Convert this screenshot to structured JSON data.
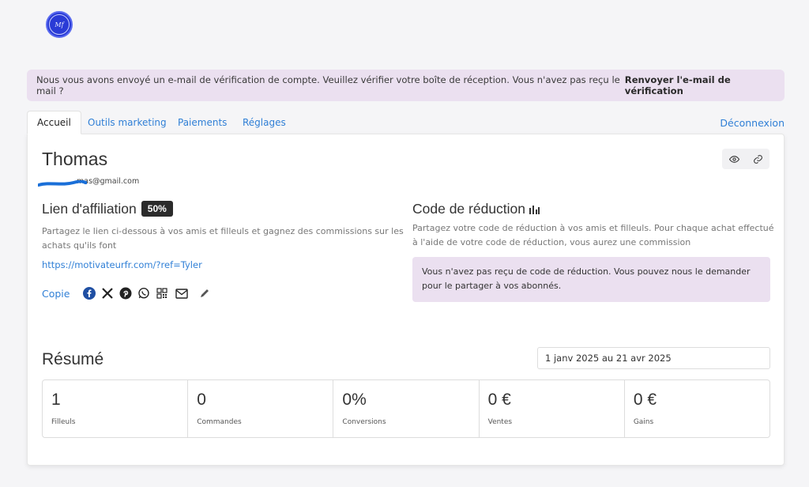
{
  "logo": {
    "text": "Mf"
  },
  "alert": {
    "message": "Nous vous avons envoyé un e-mail de vérification de compte. Veuillez vérifier votre boîte de réception. Vous n'avez pas reçu le mail ?",
    "action": "Renvoyer l'e-mail de vérification"
  },
  "tabs": [
    {
      "label": "Accueil"
    },
    {
      "label": "Outils marketing"
    },
    {
      "label": "Paiements"
    },
    {
      "label": "Réglages"
    }
  ],
  "logout_label": "Déconnexion",
  "profile": {
    "name": "Thomas",
    "email": "mas@gmail.com"
  },
  "affiliation": {
    "title": "Lien d'affiliation",
    "badge": "50%",
    "description": "Partagez le lien ci-dessous à vos amis et filleuls et gagnez des commissions sur les achats qu'ils font",
    "link": "https://motivateurfr.com/?ref=Tyler",
    "copy_label": "Copie",
    "share_icons": [
      "facebook-icon",
      "x-icon",
      "pinterest-icon",
      "whatsapp-icon",
      "qr-code-icon",
      "email-icon",
      "edit-icon"
    ]
  },
  "discount": {
    "title": "Code de réduction",
    "description": "Partagez votre code de réduction à vos amis et filleuls. Pour chaque achat effectué à l'aide de votre code de réduction, vous aurez une commission",
    "notice": "Vous n'avez pas reçu de code de réduction. Vous pouvez nous le demander pour le partager à vos abonnés."
  },
  "summary": {
    "title": "Résumé",
    "date_range": "1 janv 2025 au 21 avr 2025",
    "stats": [
      {
        "value": "1",
        "label": "Filleuls"
      },
      {
        "value": "0",
        "label": "Commandes"
      },
      {
        "value": "0%",
        "label": "Conversions"
      },
      {
        "value": "0 €",
        "label": "Ventes"
      },
      {
        "value": "0 €",
        "label": "Gains"
      }
    ]
  },
  "colors": {
    "accent": "#2f7fd6",
    "alert_bg": "#ebe0f0",
    "badge_bg": "#2b2b2b"
  }
}
